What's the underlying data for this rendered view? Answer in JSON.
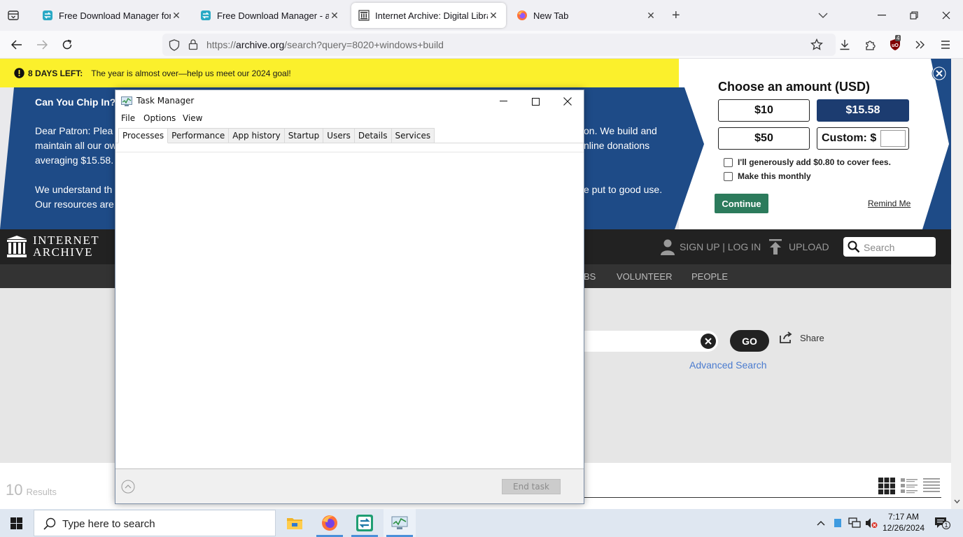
{
  "browser": {
    "tabs": [
      {
        "title": "Free Download Manager for Wi",
        "icon": "fdm-icon",
        "active": false
      },
      {
        "title": "Free Download Manager - abso",
        "icon": "fdm-icon",
        "active": false
      },
      {
        "title": "Internet Archive: Digital Library",
        "icon": "archive-icon",
        "active": true
      },
      {
        "title": "New Tab",
        "icon": "firefox-icon",
        "active": false
      }
    ],
    "close_glyph": "✕",
    "new_tab_glyph": "+",
    "url_prefix": "https://",
    "url_host": "archive.org",
    "url_path": "/search?query=8020+windows+build",
    "extension_badge": "4"
  },
  "banner": {
    "days_left": "8 DAYS LEFT:",
    "alert_message": "The year is almost over—help us meet our 2024 goal!",
    "heading": "Can You Chip In?",
    "body_lines_left": [
      "Dear Patron: Plea",
      "maintain all our ow",
      "averaging $15.58.",
      "",
      "We understand th",
      "Our resources are"
    ],
    "body_lines_right": [
      "on. We build and",
      "nline donations",
      "",
      "",
      "e put to good use.",
      ""
    ],
    "choose_title": "Choose an amount (USD)",
    "amounts": [
      "$10",
      "$15.58",
      "$50"
    ],
    "custom_label": "Custom: $",
    "cover_fees_label": "I'll generously add $0.80 to cover fees.",
    "monthly_label": "Make this monthly",
    "continue_label": "Continue",
    "remind_label": "Remind Me",
    "colors": {
      "banner_blue": "#1e4b87",
      "alert_yellow": "#fbf02c",
      "continue_green": "#2c7b5c",
      "selected_amount": "#1c3c70"
    }
  },
  "archive": {
    "logo_line1": "INTERNET",
    "logo_line2": "ARCHIVE",
    "signup_label": "SIGN UP | LOG IN",
    "upload_label": "UPLOAD",
    "search_placeholder": "Search",
    "menu_items": [
      "BS",
      "VOLUNTEER",
      "PEOPLE"
    ],
    "go_label": "GO",
    "share_label": "Share",
    "advanced_search_label": "Advanced Search",
    "results_count": "10",
    "results_label": "Results"
  },
  "task_manager": {
    "title": "Task Manager",
    "menu": [
      "File",
      "Options",
      "View"
    ],
    "tabs": [
      "Processes",
      "Performance",
      "App history",
      "Startup",
      "Users",
      "Details",
      "Services"
    ],
    "active_tab": "Processes",
    "end_task_label": "End task"
  },
  "taskbar": {
    "search_placeholder": "Type here to search",
    "apps": [
      "file-explorer-icon",
      "firefox-icon",
      "fdm-icon",
      "task-manager-icon"
    ],
    "time": "7:17 AM",
    "date": "12/26/2024",
    "notification_count": "1"
  }
}
